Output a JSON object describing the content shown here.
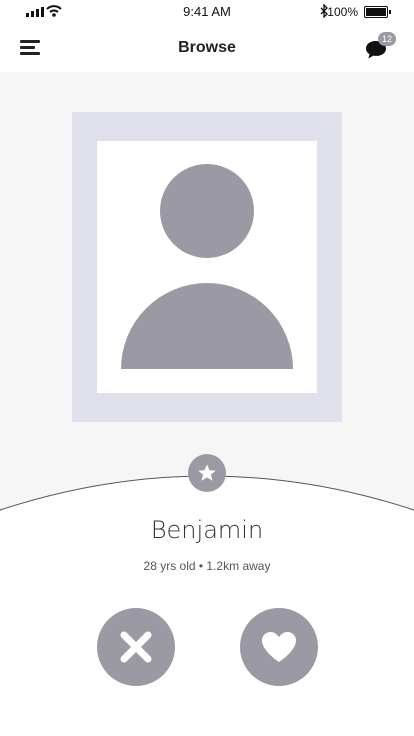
{
  "status_bar": {
    "time": "9:41 AM",
    "battery_percent": "100%",
    "icons": [
      "signal-icon",
      "wifi-icon",
      "bluetooth-icon",
      "battery-icon"
    ]
  },
  "nav": {
    "title": "Browse",
    "menu_icon": "hamburger-menu-icon",
    "chat_icon": "chat-bubble-icon",
    "chat_badge_count": "12"
  },
  "profile": {
    "name": "Benjamin",
    "details": "28 yrs old • 1.2km away",
    "photo": "avatar-placeholder"
  },
  "actions": {
    "favorite_icon": "star-icon",
    "dislike_icon": "close-icon",
    "like_icon": "heart-icon"
  },
  "colors": {
    "accent_gray": "#9b9aa4",
    "frame_lavender": "#e0e0ec",
    "background": "#f6f6f6"
  }
}
